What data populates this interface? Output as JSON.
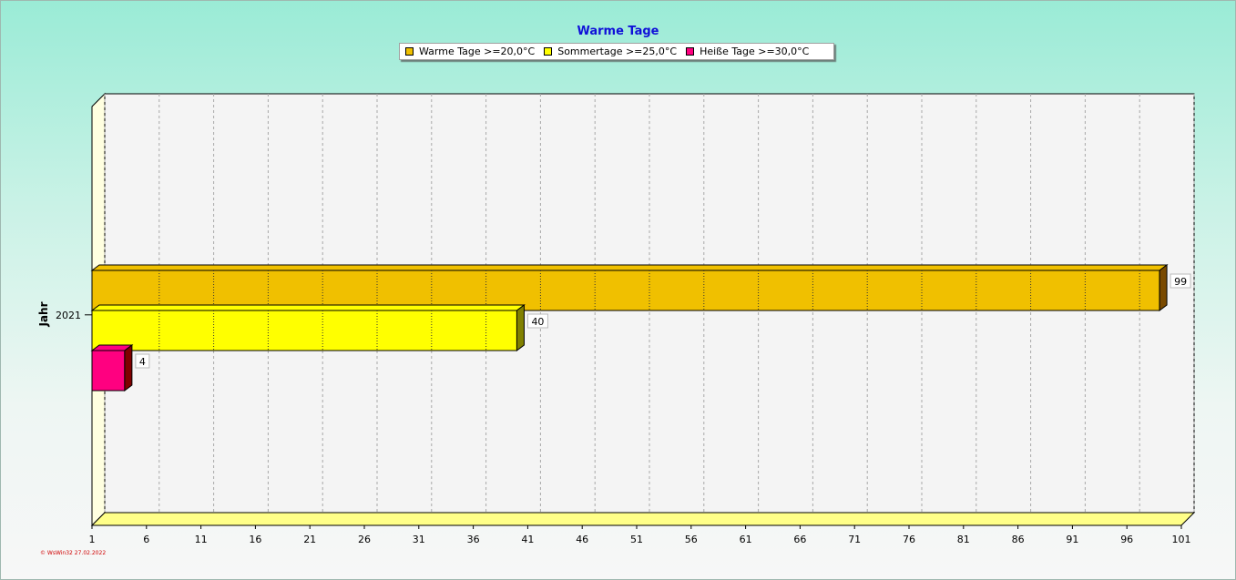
{
  "chart_data": {
    "type": "bar",
    "orientation": "horizontal",
    "title": "Warme Tage",
    "ylabel": "Jahr",
    "xlabel": "",
    "categories": [
      "2021"
    ],
    "series": [
      {
        "name": "Warme Tage >=20,0°C",
        "values": [
          99
        ],
        "color": "#f0c000"
      },
      {
        "name": "Sommertage >=25,0°C",
        "values": [
          40
        ],
        "color": "#ffff00"
      },
      {
        "name": "Heiße Tage >=30,0°C",
        "values": [
          4
        ],
        "color": "#ff0080"
      }
    ],
    "xlim": [
      1,
      101
    ],
    "xticks": [
      1,
      6,
      11,
      16,
      21,
      26,
      31,
      36,
      41,
      46,
      51,
      56,
      61,
      66,
      71,
      76,
      81,
      86,
      91,
      96,
      101
    ],
    "grid": true,
    "legend_position": "top-center",
    "three_d": true
  },
  "footer_text": "© WsWin32  27.02.2022"
}
